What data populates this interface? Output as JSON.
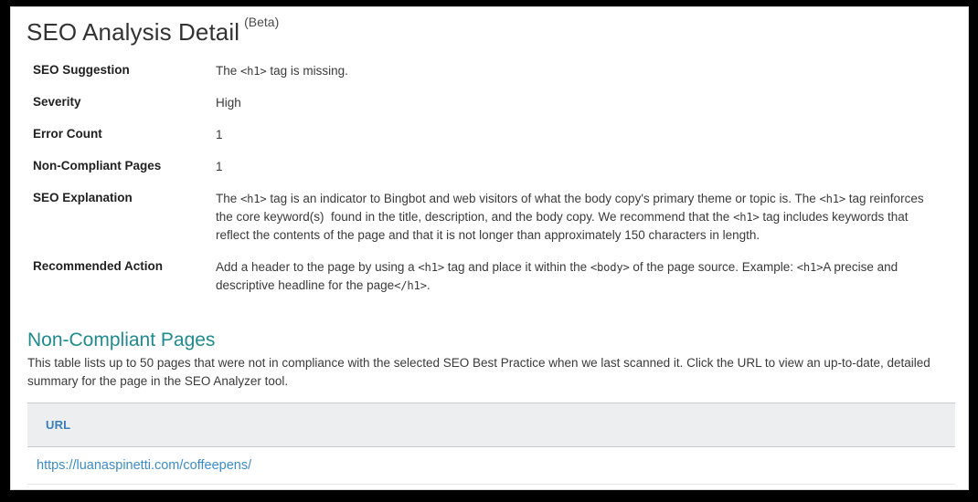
{
  "page": {
    "title": "SEO Analysis Detail",
    "title_superscript": "(Beta)"
  },
  "details": {
    "rows": [
      {
        "label": "SEO Suggestion",
        "value": "The <h1> tag is missing."
      },
      {
        "label": "Severity",
        "value": "High"
      },
      {
        "label": "Error Count",
        "value": "1"
      },
      {
        "label": "Non-Compliant Pages",
        "value": "1"
      },
      {
        "label": "SEO Explanation",
        "value": "The <h1> tag is an indicator to Bingbot and web visitors of what the body copy's primary theme or topic is.  The <h1> tag reinforces the core keyword(s)  found in the title, description, and the body copy. We recommend that the <h1> tag includes keywords that reflect the contents of the page and that it is not longer than approximately 150 characters in length."
      },
      {
        "label": "Recommended Action",
        "value": "Add a header to the page by using a <h1> tag and place it within the <body> of the page source. Example: <h1>A precise and descriptive headline for the page</h1>."
      }
    ]
  },
  "non_compliant_section": {
    "heading": "Non-Compliant Pages",
    "description": "This table lists up to 50 pages that were not in compliance with the selected SEO Best Practice when we last scanned it. Click the URL to view an up-to-date, detailed summary for the page in the SEO Analyzer tool.",
    "table": {
      "columns": [
        "URL"
      ],
      "rows": [
        {
          "url": "https://luanaspinetti.com/coffeepens/"
        }
      ]
    }
  },
  "colors": {
    "heading_teal": "#1f8a8f",
    "link_blue": "#3b8cc9",
    "table_header_blue": "#3a7dbb",
    "table_header_bg": "#eceef0",
    "body_text": "#3a3a3a",
    "term_text": "#212121",
    "frame": "#000000"
  }
}
